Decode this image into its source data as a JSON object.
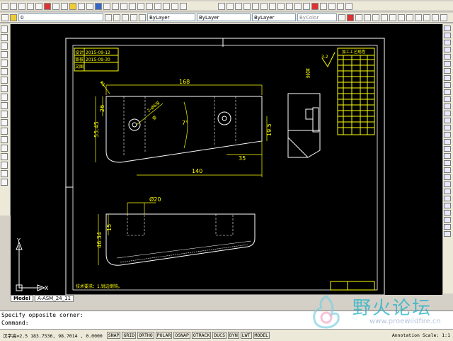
{
  "toolbar": {
    "layer_value": "0",
    "color_value": "ByLayer",
    "linetype_value": "ByLayer",
    "lineweight_value": "ByLayer",
    "plotstyle_value": "ByColor"
  },
  "drawing": {
    "title_block": {
      "design_label": "设计",
      "design_date": "2015-09-12",
      "check_label": "审核",
      "check_date": "2015-09-30",
      "doc_label": "文图"
    },
    "roughness": {
      "text": "其余",
      "value": "3.2"
    },
    "process_table_title": "加工工艺规程",
    "dims": {
      "d168": "168",
      "d26": "26",
      "d5545": "55.45",
      "d7": "7°",
      "d195": "19.5",
      "d35": "35",
      "d140": "140",
      "d20": "Ø20",
      "d15": "15",
      "d4634": "46.34",
      "hole_note": "2-Ø6深",
      "hole_note2": "穿",
      "r_label": "R5"
    },
    "tech_req": "技术要求：1.锐边倒钝。"
  },
  "ucs": {
    "x": "X",
    "y": "Y"
  },
  "tabs": [
    "Model",
    "A-ASM_24_11"
  ],
  "command_line": {
    "line1": "Specify opposite corner:",
    "line2": "Command:"
  },
  "status": {
    "coords": "汉字高=2.5  183.7536, 98.7014 , 0.0000",
    "buttons": [
      "SNAP",
      "GRID",
      "ORTHO",
      "POLAR",
      "OSNAP",
      "OTRACK",
      "DUCS",
      "DYN",
      "LWT",
      "MODEL"
    ],
    "annotation": "Annotation Scale: 1:1"
  },
  "watermark": {
    "main": "野火论坛",
    "sub": "www.proewildfire.cn"
  },
  "colors": {
    "canvas": "#000000",
    "line": "#ffffff",
    "dim": "#ffff00",
    "frame": "#ffffff"
  }
}
